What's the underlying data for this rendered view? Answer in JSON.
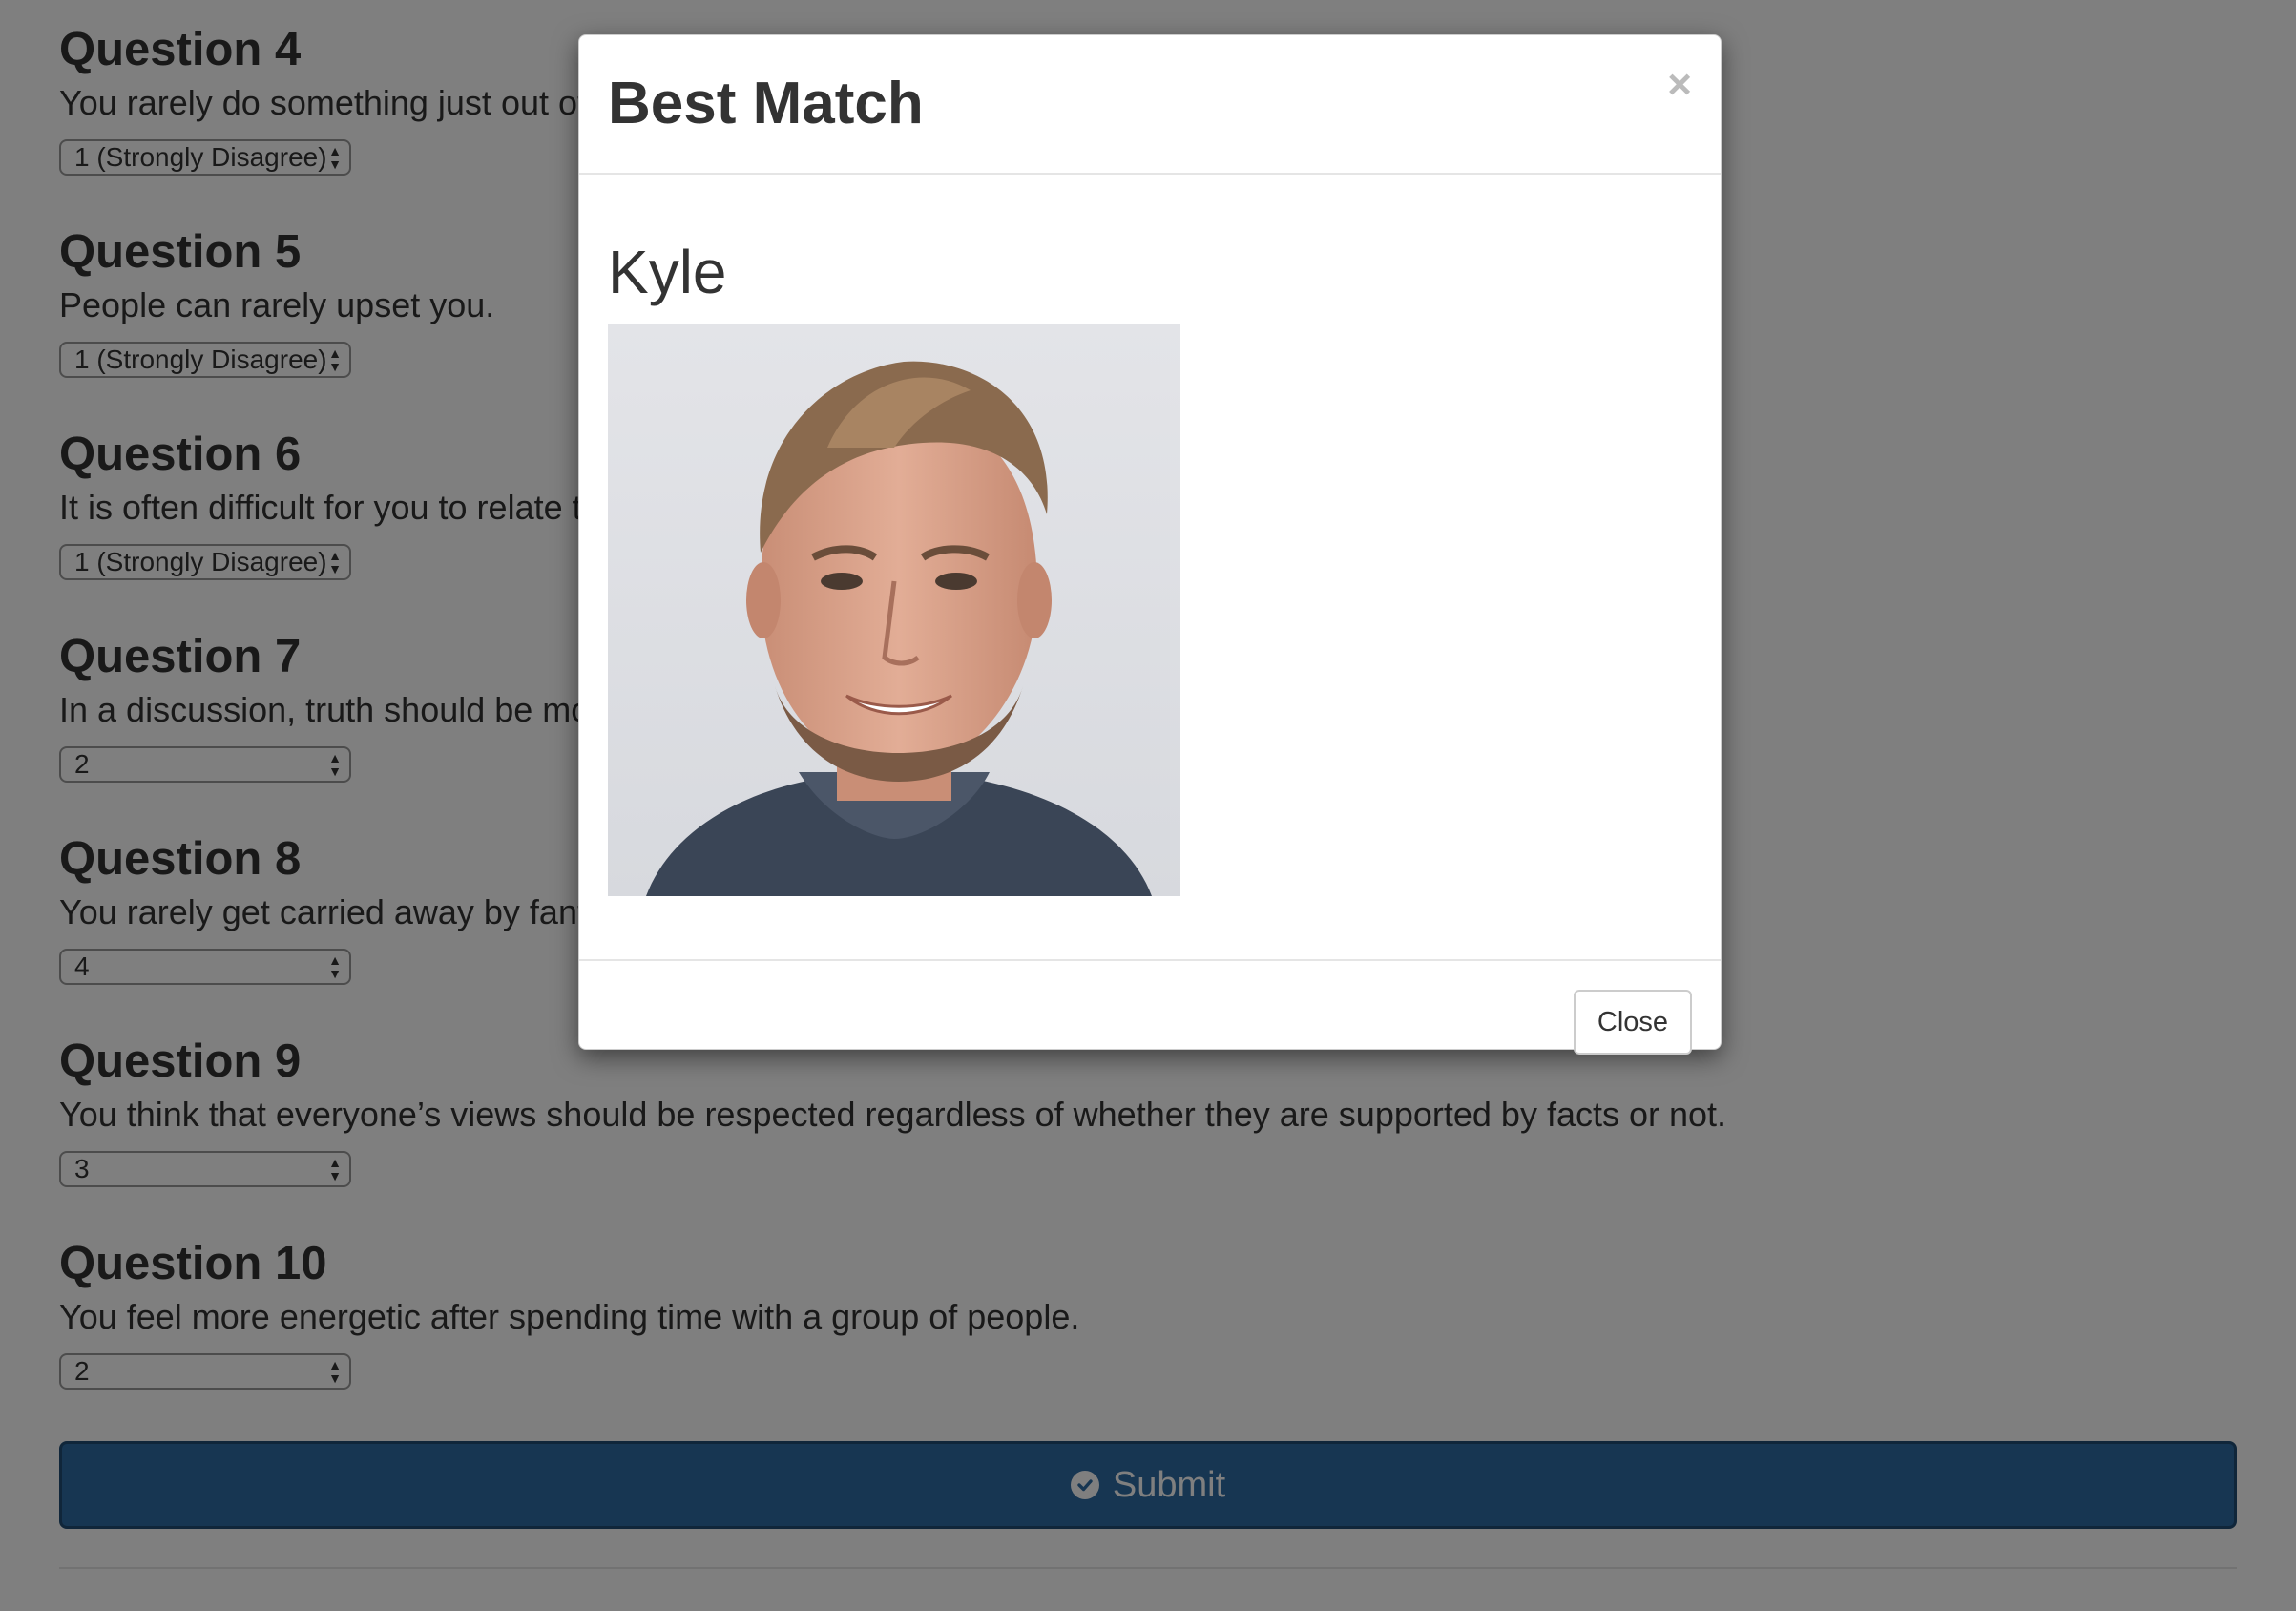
{
  "questions": [
    {
      "title": "Question 4",
      "text": "You rarely do something just out of sheer curiosity.",
      "value": "1 (Strongly Disagree)"
    },
    {
      "title": "Question 5",
      "text": "People can rarely upset you.",
      "value": "1 (Strongly Disagree)"
    },
    {
      "title": "Question 6",
      "text": "It is often difficult for you to relate to other people’s feelings.",
      "value": "1 (Strongly Disagree)"
    },
    {
      "title": "Question 7",
      "text": "In a discussion, truth should be more important than people’s sensitivities.",
      "value": "2"
    },
    {
      "title": "Question 8",
      "text": "You rarely get carried away by fantasies and ideas.",
      "value": "4"
    },
    {
      "title": "Question 9",
      "text": "You think that everyone’s views should be respected regardless of whether they are supported by facts or not.",
      "value": "3"
    },
    {
      "title": "Question 10",
      "text": "You feel more energetic after spending time with a group of people.",
      "value": "2"
    }
  ],
  "submit": {
    "label": "Submit",
    "icon": "check-circle-icon"
  },
  "modal": {
    "title": "Best Match",
    "close_symbol": "×",
    "match_name": "Kyle",
    "close_button_label": "Close"
  },
  "colors": {
    "primary": "#2e6da4",
    "backdrop": "rgba(0,0,0,0.5)"
  }
}
